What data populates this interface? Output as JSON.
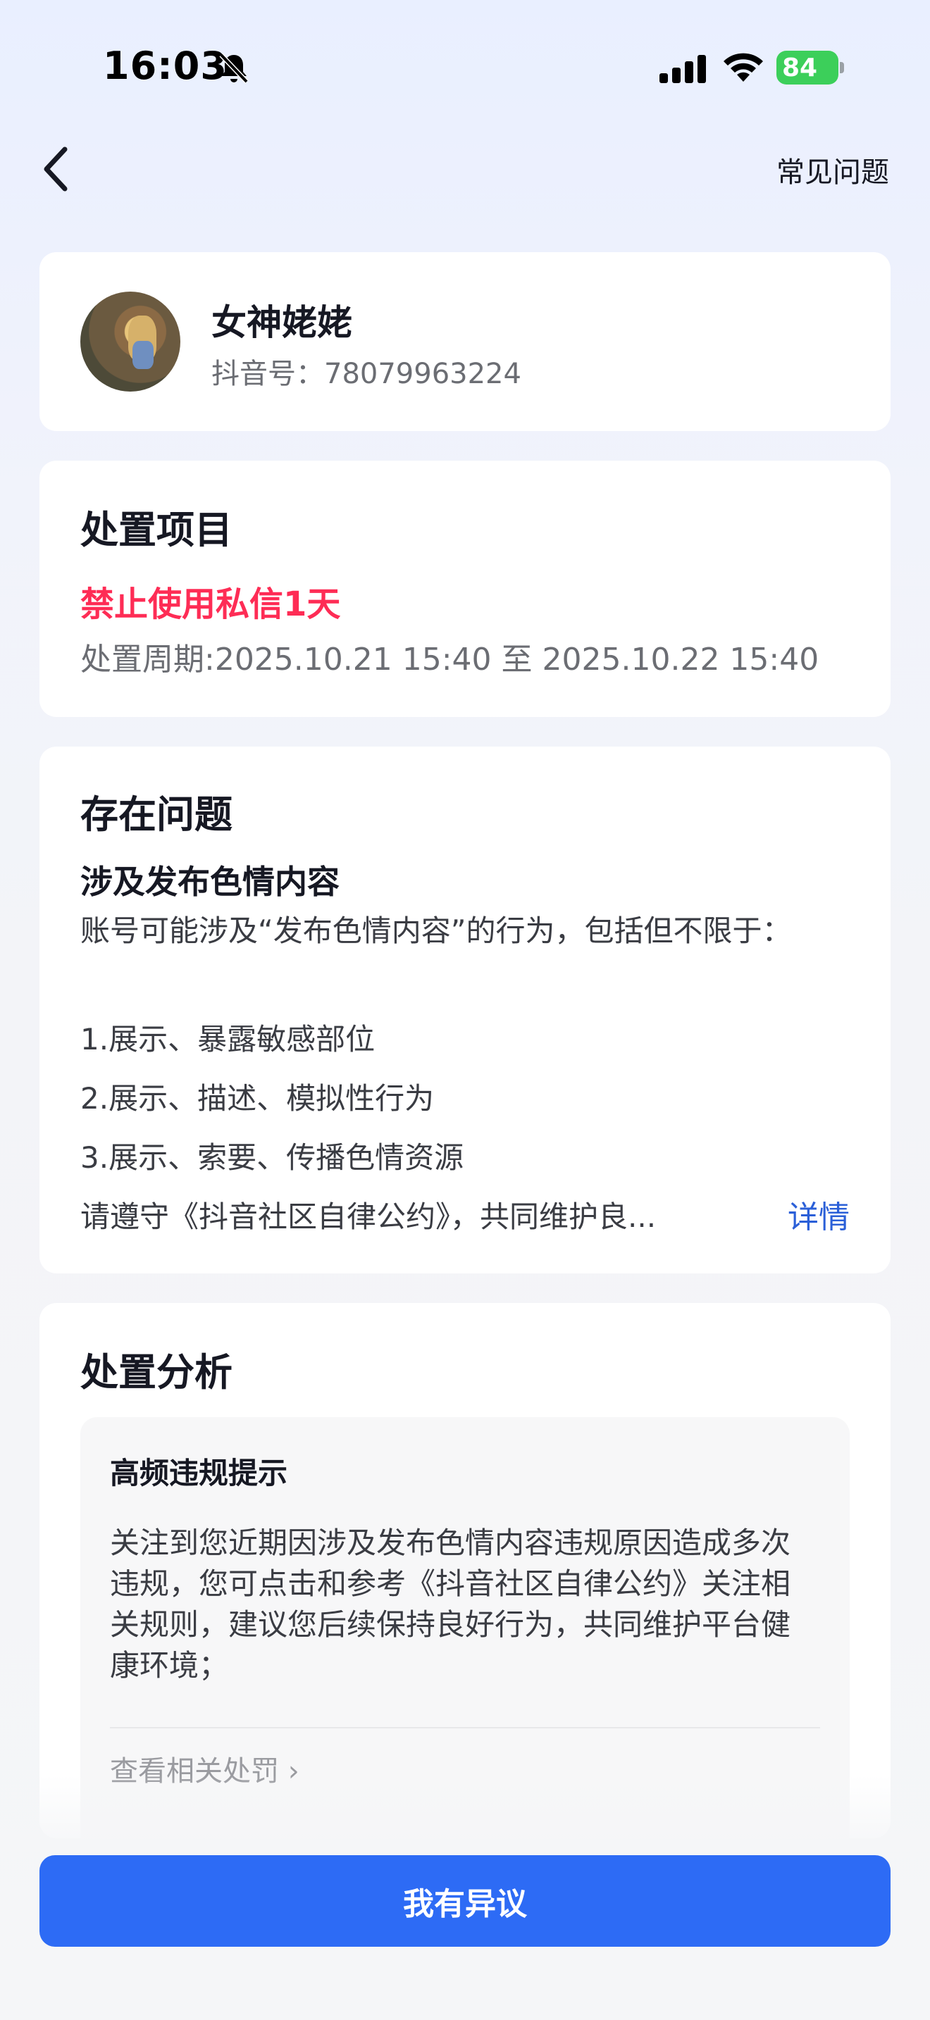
{
  "status_bar": {
    "time": "16:03",
    "battery": "84"
  },
  "nav": {
    "faq": "常见问题"
  },
  "user": {
    "name": "女神姥姥",
    "id_label": "抖音号：78079963224"
  },
  "action_card": {
    "title": "处置项目",
    "item": "禁止使用私信1天",
    "period": "处置周期:2025.10.21 15:40 至 2025.10.22 15:40"
  },
  "issue_card": {
    "title": "存在问题",
    "subtitle": "涉及发布色情内容",
    "description": "账号可能涉及“发布色情内容”的行为，包括但不限于：",
    "items": [
      "1.展示、暴露敏感部位",
      "2.展示、描述、模拟性行为",
      "3.展示、索要、传播色情资源"
    ],
    "note": "请遵守《抖音社区自律公约》，共同维护良...",
    "detail_link": "详情"
  },
  "analysis_card": {
    "title": "处置分析",
    "hint_title": "高频违规提示",
    "hint_body": "关注到您近期因涉及发布色情内容违规原因造成多次违规，您可点击和参考《抖音社区自律公约》关注相关规则，建议您后续保持良好行为，共同维护平台健康环境；",
    "hint_link": "查看相关处罚 ›"
  },
  "bottom": {
    "appeal_button": "我有异议"
  },
  "colors": {
    "accent_red": "#fe2c55",
    "button_blue": "#2d6bf5",
    "link_blue": "#2a5fd8",
    "battery_green": "#3ccf5a"
  },
  "icons": [
    "bell-off-icon",
    "signal-icon",
    "wifi-icon",
    "battery-icon",
    "back-arrow-icon"
  ]
}
